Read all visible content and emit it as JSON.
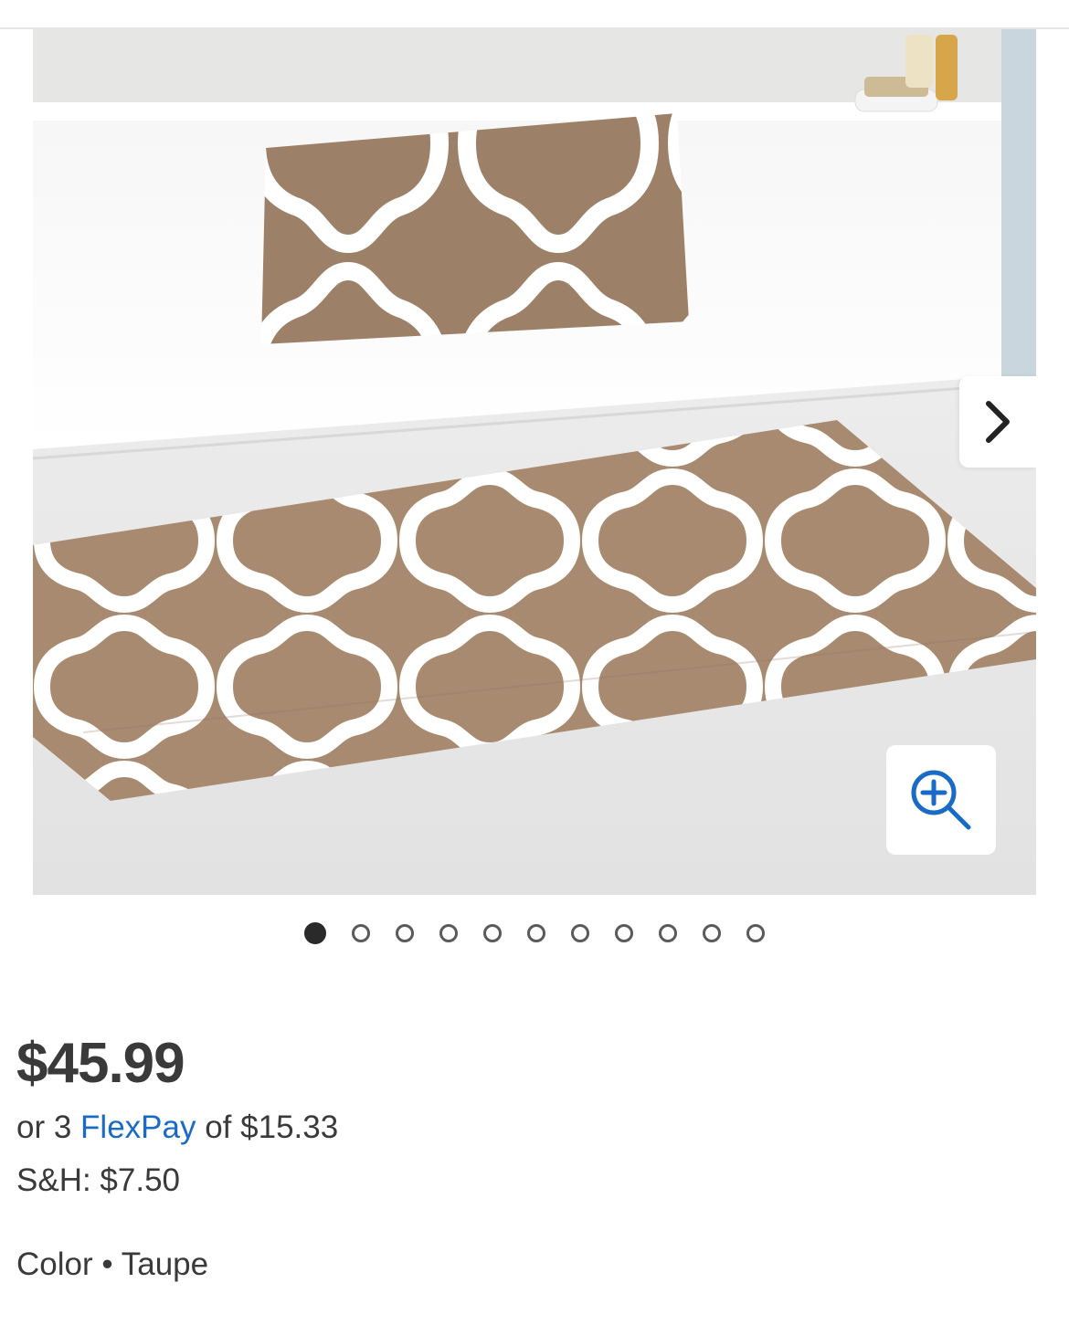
{
  "product": {
    "image_alt": "Taupe and white quatrefoil bath rug set",
    "price": "$45.99",
    "flexpay": {
      "prefix": "or 3",
      "link_label": "FlexPay",
      "suffix": "of $15.33"
    },
    "shipping": "S&H: $7.50",
    "color": {
      "label": "Color",
      "separator": "•",
      "value": "Taupe"
    }
  },
  "gallery": {
    "dot_count": 11,
    "active_index": 0,
    "next_icon": "chevron-right-icon",
    "zoom_icon": "zoom-in-icon"
  },
  "colors": {
    "rug_taupe": "#a88a70",
    "flexpay_link": "#1a6bc8",
    "zoom_icon": "#1a6bc8",
    "text": "#3a3a3a"
  }
}
